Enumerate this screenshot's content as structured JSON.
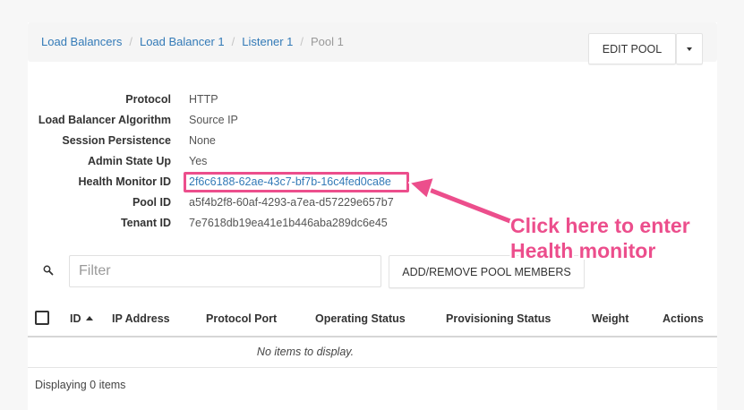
{
  "breadcrumb": [
    {
      "label": "Load Balancers"
    },
    {
      "label": "Load Balancer 1"
    },
    {
      "label": "Listener 1"
    },
    {
      "label": "Pool 1"
    }
  ],
  "actions": {
    "edit_label": "EDIT POOL"
  },
  "details": [
    {
      "label": "Protocol",
      "value": "HTTP"
    },
    {
      "label": "Load Balancer Algorithm",
      "value": "Source IP"
    },
    {
      "label": "Session Persistence",
      "value": "None"
    },
    {
      "label": "Admin State Up",
      "value": "Yes"
    },
    {
      "label": "Health Monitor ID",
      "value": "2f6c6188-62ae-43c7-bf7b-16c4fed0ca8e"
    },
    {
      "label": "Pool ID",
      "value": "a5f4b2f8-60af-4293-a7ea-d57229e657b7"
    },
    {
      "label": "Tenant ID",
      "value": "7e7618db19ea41e1b446aba289dc6e45"
    }
  ],
  "members": {
    "filter_placeholder": "Filter",
    "add_remove_label": "ADD/REMOVE POOL MEMBERS",
    "columns": [
      "ID",
      "IP Address",
      "Protocol Port",
      "Operating Status",
      "Provisioning Status",
      "Weight",
      "Actions"
    ],
    "empty_message": "No items to display.",
    "footer": "Displaying 0 items"
  },
  "annotation": {
    "line1": "Click here to enter",
    "line2": "Health monitor"
  },
  "colors": {
    "link": "#337ab7",
    "annotation": "#ec4e8c"
  },
  "icons": {
    "search": "search-icon",
    "caret": "caret-down-icon",
    "sort": "sort-ascending-icon"
  }
}
